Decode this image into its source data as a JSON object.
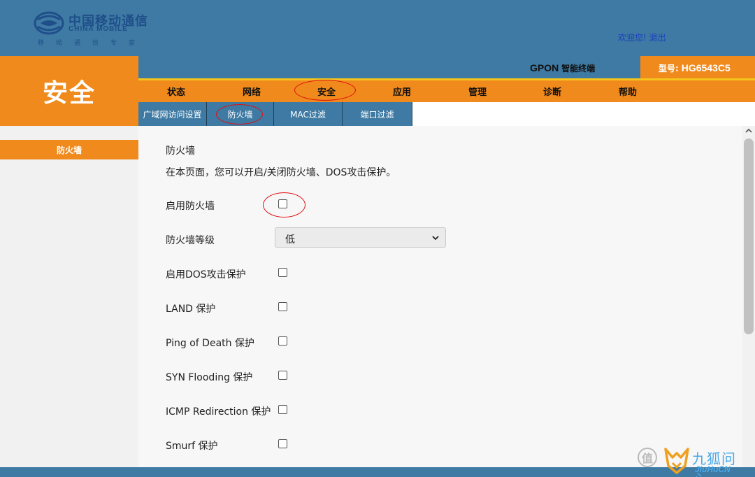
{
  "header": {
    "logo_cn": "中国移动通信",
    "logo_en": "CHINA MOBILE",
    "logo_slogan": "移动通信专家",
    "welcome": "欢迎您!",
    "logout": "退出"
  },
  "section": {
    "title": "安全"
  },
  "product": {
    "type": "GPON",
    "desc": "智能终端",
    "model_label": "型号:",
    "model": "HG6543C5"
  },
  "mainnav": {
    "tabs": [
      "状态",
      "网络",
      "安全",
      "应用",
      "管理",
      "诊断",
      "帮助"
    ],
    "active": "安全"
  },
  "subnav": {
    "tabs": [
      "广域网访问设置",
      "防火墙",
      "MAC过滤",
      "端口过滤"
    ],
    "active": "防火墙"
  },
  "leftmenu": {
    "items": [
      "防火墙"
    ]
  },
  "content": {
    "title": "防火墙",
    "description": "在本页面，您可以开启/关闭防火墙、DOS攻击保护。",
    "enable_firewall": {
      "label": "启用防火墙",
      "checked": false
    },
    "firewall_level": {
      "label": "防火墙等级",
      "value": "低"
    },
    "options": [
      {
        "label": "启用DOS攻击保护",
        "checked": false
      },
      {
        "label": "LAND 保护",
        "checked": false
      },
      {
        "label": "Ping of Death 保护",
        "checked": false
      },
      {
        "label": "SYN Flooding 保护",
        "checked": false
      },
      {
        "label": "ICMP Redirection 保护",
        "checked": false
      },
      {
        "label": "Smurf 保护",
        "checked": false
      }
    ]
  },
  "watermark": {
    "zhi": "值",
    "cn": "九狐问心",
    "en": "JiuHuCN"
  },
  "colors": {
    "orange": "#f08a1c",
    "blue": "#3e7aa3",
    "yellow": "#f4c51c",
    "link": "#1c3fbf",
    "annotation": "#e01010"
  }
}
